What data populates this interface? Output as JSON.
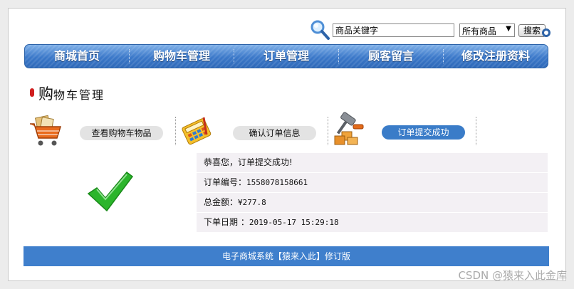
{
  "search": {
    "value": "商品关键字",
    "category": "所有商品",
    "button_label": "搜索"
  },
  "nav": {
    "items": [
      "商城首页",
      "购物车管理",
      "订单管理",
      "顾客留言",
      "修改注册资料"
    ]
  },
  "page_title": {
    "first_char": "购",
    "rest": "物车管理"
  },
  "steps": [
    {
      "label": "查看购物车物品",
      "state": "done"
    },
    {
      "label": "确认订单信息",
      "state": "done"
    },
    {
      "label": "订单提交成功",
      "state": "active"
    }
  ],
  "order": {
    "success_message": "恭喜您，订单提交成功!",
    "number_label": "订单编号：",
    "number": "1558078158661",
    "total_label": "总金额：",
    "total": "¥277.8",
    "date_label": "下单日期 ：",
    "date": "2019-05-17 15:29:18"
  },
  "footer": {
    "text": "电子商城系统【猿来入此】修订版"
  },
  "watermark": "CSDN @猿来入此金库",
  "colors": {
    "nav_blue": "#3b78c9",
    "footer_blue": "#3f7fcc",
    "active_step": "#3a7cc8",
    "check_green": "#2bb52b"
  }
}
